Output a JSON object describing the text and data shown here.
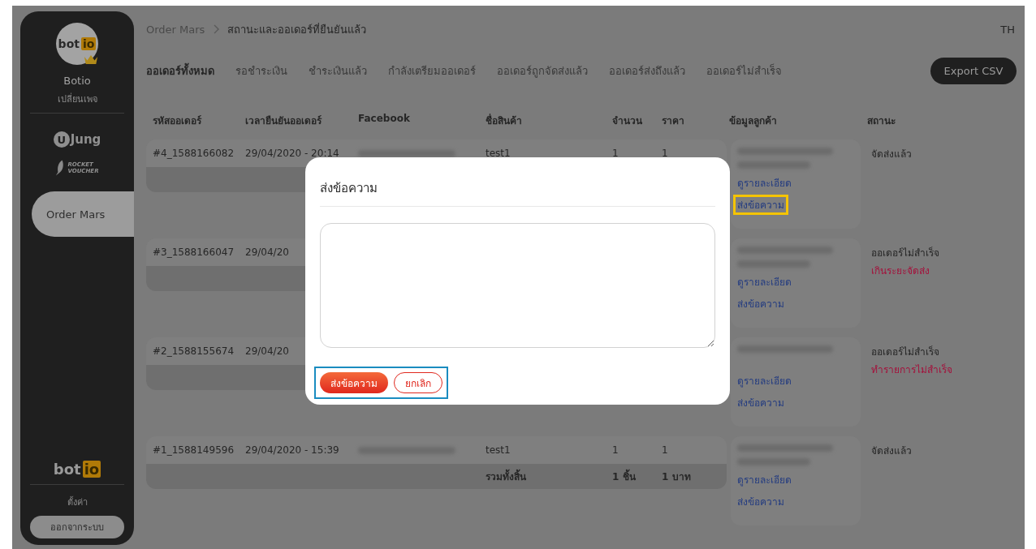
{
  "sidebar": {
    "logo": {
      "left": "bot",
      "right": "io"
    },
    "page_name": "Botio",
    "switch_page": "เปลี่ยนเพจ",
    "apps": [
      {
        "kind": "ujung",
        "mark": "U",
        "label": "Jung",
        "selected": false
      },
      {
        "kind": "rocket",
        "lines": [
          "ROCKET",
          "VOUCHER"
        ],
        "selected": false
      },
      {
        "kind": "text",
        "label": "Order Mars",
        "selected": true
      }
    ],
    "footer_logo": {
      "left": "bot",
      "right": "io"
    },
    "settings": "ตั้งค่า",
    "logout": "ออกจากระบบ"
  },
  "breadcrumb": [
    "Order Mars",
    "สถานะและออเดอร์ที่ยืนยันแล้ว"
  ],
  "language": "TH",
  "tabs": [
    {
      "label": "ออเดอร์ทั้งหมด",
      "selected": true
    },
    {
      "label": "รอชำระเงิน",
      "selected": false
    },
    {
      "label": "ชำระเงินแล้ว",
      "selected": false
    },
    {
      "label": "กำลังเตรียมออเดอร์",
      "selected": false
    },
    {
      "label": "ออเดอร์ถูกจัดส่งแล้ว",
      "selected": false
    },
    {
      "label": "ออเดอร์ส่งถึงแล้ว",
      "selected": false
    },
    {
      "label": "ออเดอร์ไม่สำเร็จ",
      "selected": false
    }
  ],
  "export_button": "Export CSV",
  "table": {
    "columns": [
      "รหัสออเดอร์",
      "เวลายืนยันออเดอร์",
      "Facebook",
      "ชื่อสินค้า",
      "จำนวน",
      "ราคา",
      "ข้อมูลลูกค้า",
      "สถานะ"
    ],
    "rows": [
      {
        "id": "#4_1588166082",
        "date": "29/04/2020 - 20:14",
        "facebook_redacted": true,
        "product": "test1",
        "quantity": "1",
        "price": "1",
        "customer": {
          "name_redacted": true,
          "phone_redacted": true,
          "details": "ดูรายละเอียด",
          "message": {
            "label": "ส่งข้อความ",
            "highlighted": true
          }
        },
        "status": {
          "text": "จัดส่งแล้ว"
        }
      },
      {
        "id": "#3_1588166047",
        "date": "29/04/20",
        "customer": {
          "name_redacted": true,
          "phone_redacted": true,
          "details": "ดูรายละเอียด",
          "message": {
            "label": "ส่งข้อความ",
            "highlighted": false
          }
        },
        "status": {
          "text": "ออเดอร์ไม่สำเร็จ",
          "reason": "เกินระยะจัดส่ง"
        }
      },
      {
        "id": "#2_1588155674",
        "date": "29/04/20",
        "customer": {
          "name_redacted": true,
          "phone_redacted": false,
          "details": "ดูรายละเอียด",
          "message": {
            "label": "ส่งข้อความ",
            "highlighted": false
          }
        },
        "status": {
          "text": "ออเดอร์ไม่สำเร็จ",
          "reason": "ทำรายการไม่สำเร็จ"
        }
      },
      {
        "id": "#1_1588149596",
        "date": "29/04/2020 - 15:39",
        "facebook_redacted": true,
        "product": "test1",
        "quantity": "1",
        "price": "1",
        "total": {
          "label": "รวมทั้งสิ้น",
          "quantity": "1 ชิ้น",
          "price": "1 บาท"
        },
        "customer": {
          "name_redacted": true,
          "phone_redacted": true,
          "details": "ดูรายละเอียด",
          "message": {
            "label": "ส่งข้อความ",
            "highlighted": false
          }
        },
        "status": {
          "text": "จัดส่งแล้ว"
        }
      }
    ]
  },
  "modal": {
    "title": "ส่งข้อความ",
    "buttons_highlighted": true,
    "buttons": [
      {
        "kind": "primary",
        "label": "ส่งข้อความ"
      },
      {
        "kind": "outline",
        "label": "ยกเลิก"
      }
    ]
  }
}
